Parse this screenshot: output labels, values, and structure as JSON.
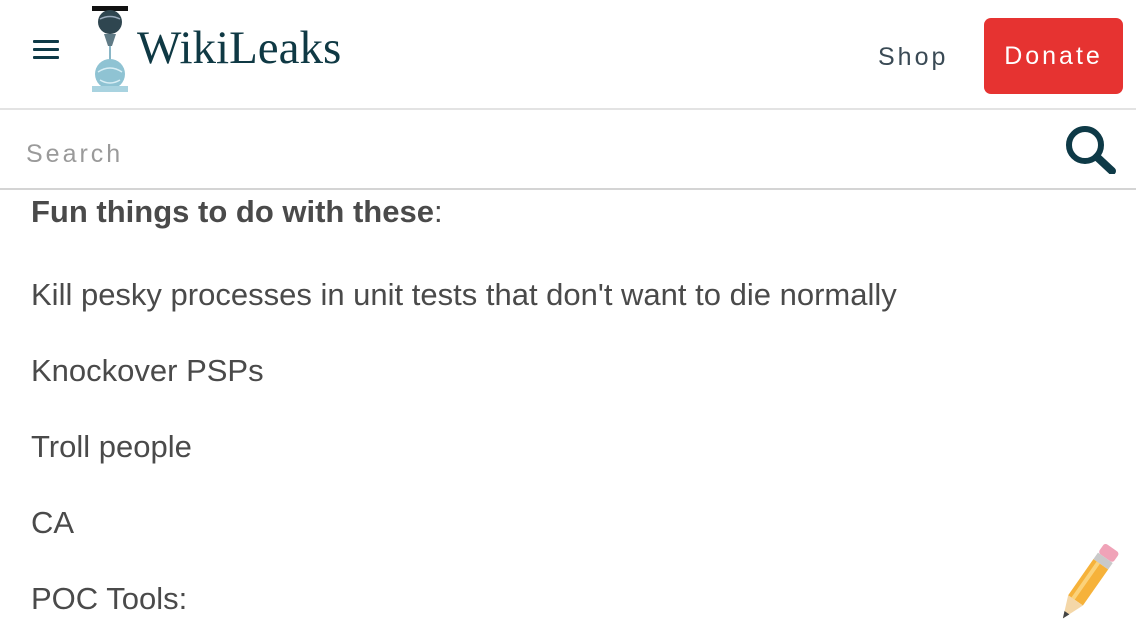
{
  "header": {
    "menu_icon": "hamburger-menu-icon",
    "logo_icon": "wikileaks-hourglass-logo",
    "logo_text": "WikiLeaks",
    "shop_label": "Shop",
    "donate_label": "Donate",
    "donate_color": "#e63331"
  },
  "search": {
    "placeholder": "Search",
    "icon": "search-icon"
  },
  "content": {
    "heading_bold": "Fun things to do with these",
    "heading_suffix": ":",
    "items": [
      "Kill pesky processes in unit tests that don't want to die normally",
      "Knockover PSPs",
      "Troll people",
      "CA",
      "POC Tools:"
    ]
  },
  "overlay": {
    "icon": "pencil-icon"
  }
}
